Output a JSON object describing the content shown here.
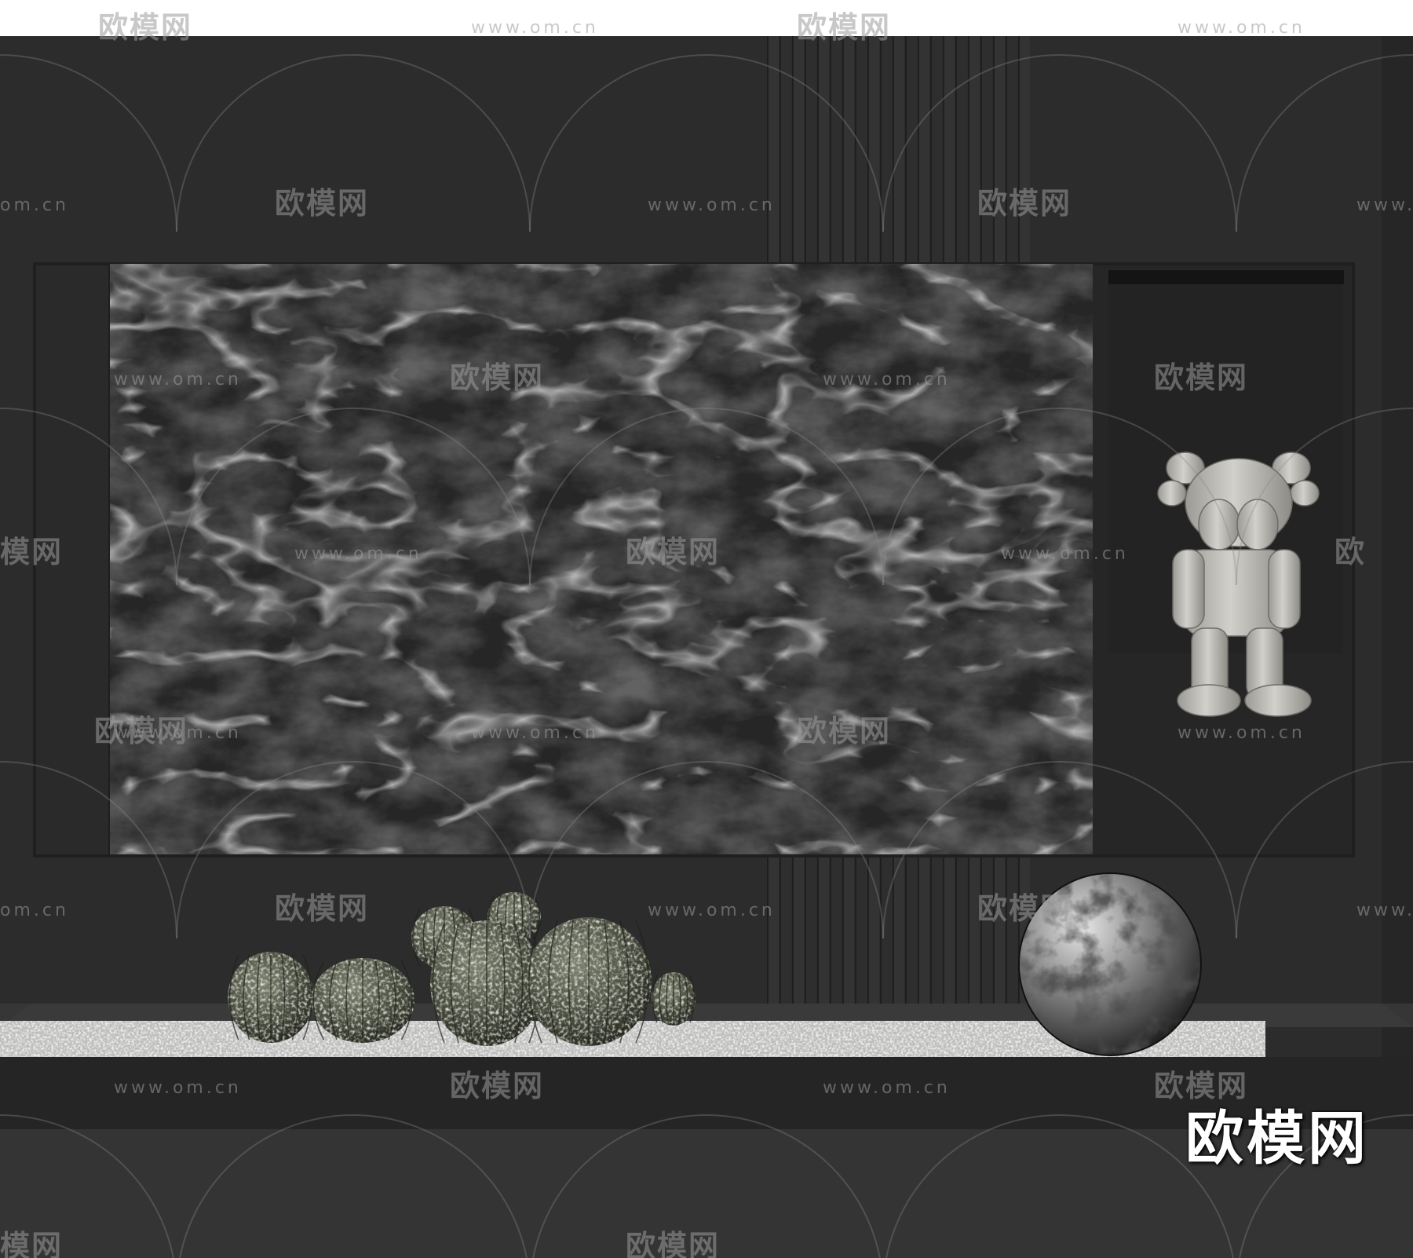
{
  "scene": {
    "description_colors": {
      "background": "#ffffff",
      "wall": "#2b2b2b",
      "recess": "#1e1e1e",
      "marble": "#1c1c1c",
      "floor": "#333333",
      "gravel": "#cfcfcf",
      "figurine": "#c8c6c1"
    }
  },
  "watermark": {
    "brand_cn": "欧模网",
    "url": "www.om.cn",
    "url_partial": "om.cn",
    "url_left_partial": "www.",
    "brand_partial": "模网",
    "brand_left_partial": "欧"
  },
  "brand_logo": {
    "text": "欧模网"
  }
}
